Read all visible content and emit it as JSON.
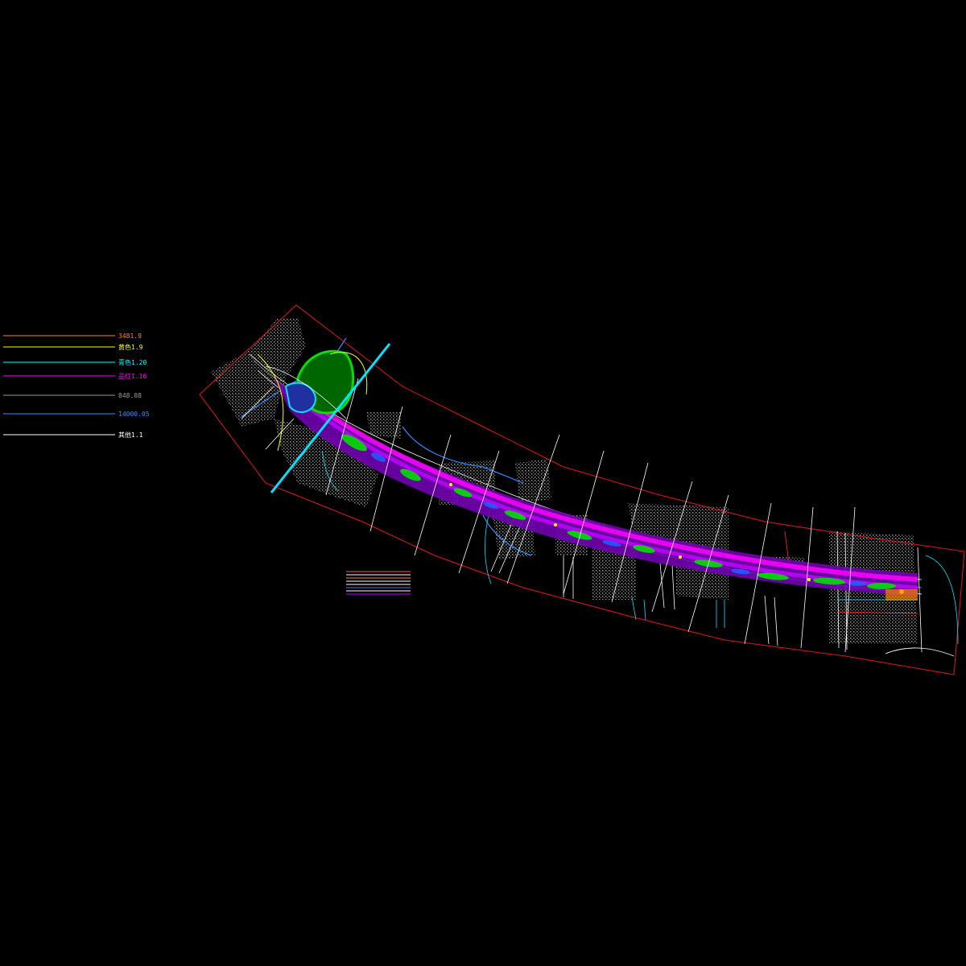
{
  "legend": [
    {
      "label": "3481.9",
      "color": "#ff7f3f"
    },
    {
      "label": "黄色1.9",
      "color": "#ffff00"
    },
    {
      "label": "青色1.20",
      "color": "#00ffff"
    },
    {
      "label": "品红1.16",
      "color": "#ff00ff"
    },
    {
      "label": "848.08",
      "color": "#9a9a9a"
    },
    {
      "label": "14000.05",
      "color": "#2f8fff"
    },
    {
      "label": "其他1.1",
      "color": "#ffffff"
    }
  ],
  "colors": {
    "background": "#000000",
    "boundary": "#e01818",
    "road_primary": "#c000ff",
    "green_space": "#00e000",
    "water": "#2060ff",
    "cyan_line": "#00e5ff",
    "hatch": "#a0a0a0",
    "white_line": "#ffffff",
    "yellow_line": "#ffff00"
  },
  "small_legend_lines": [
    "#ff5050",
    "#ffffff",
    "#ff8080",
    "#ffffff",
    "#ffffff",
    "#4080ff",
    "#ffffff",
    "#c000ff"
  ]
}
